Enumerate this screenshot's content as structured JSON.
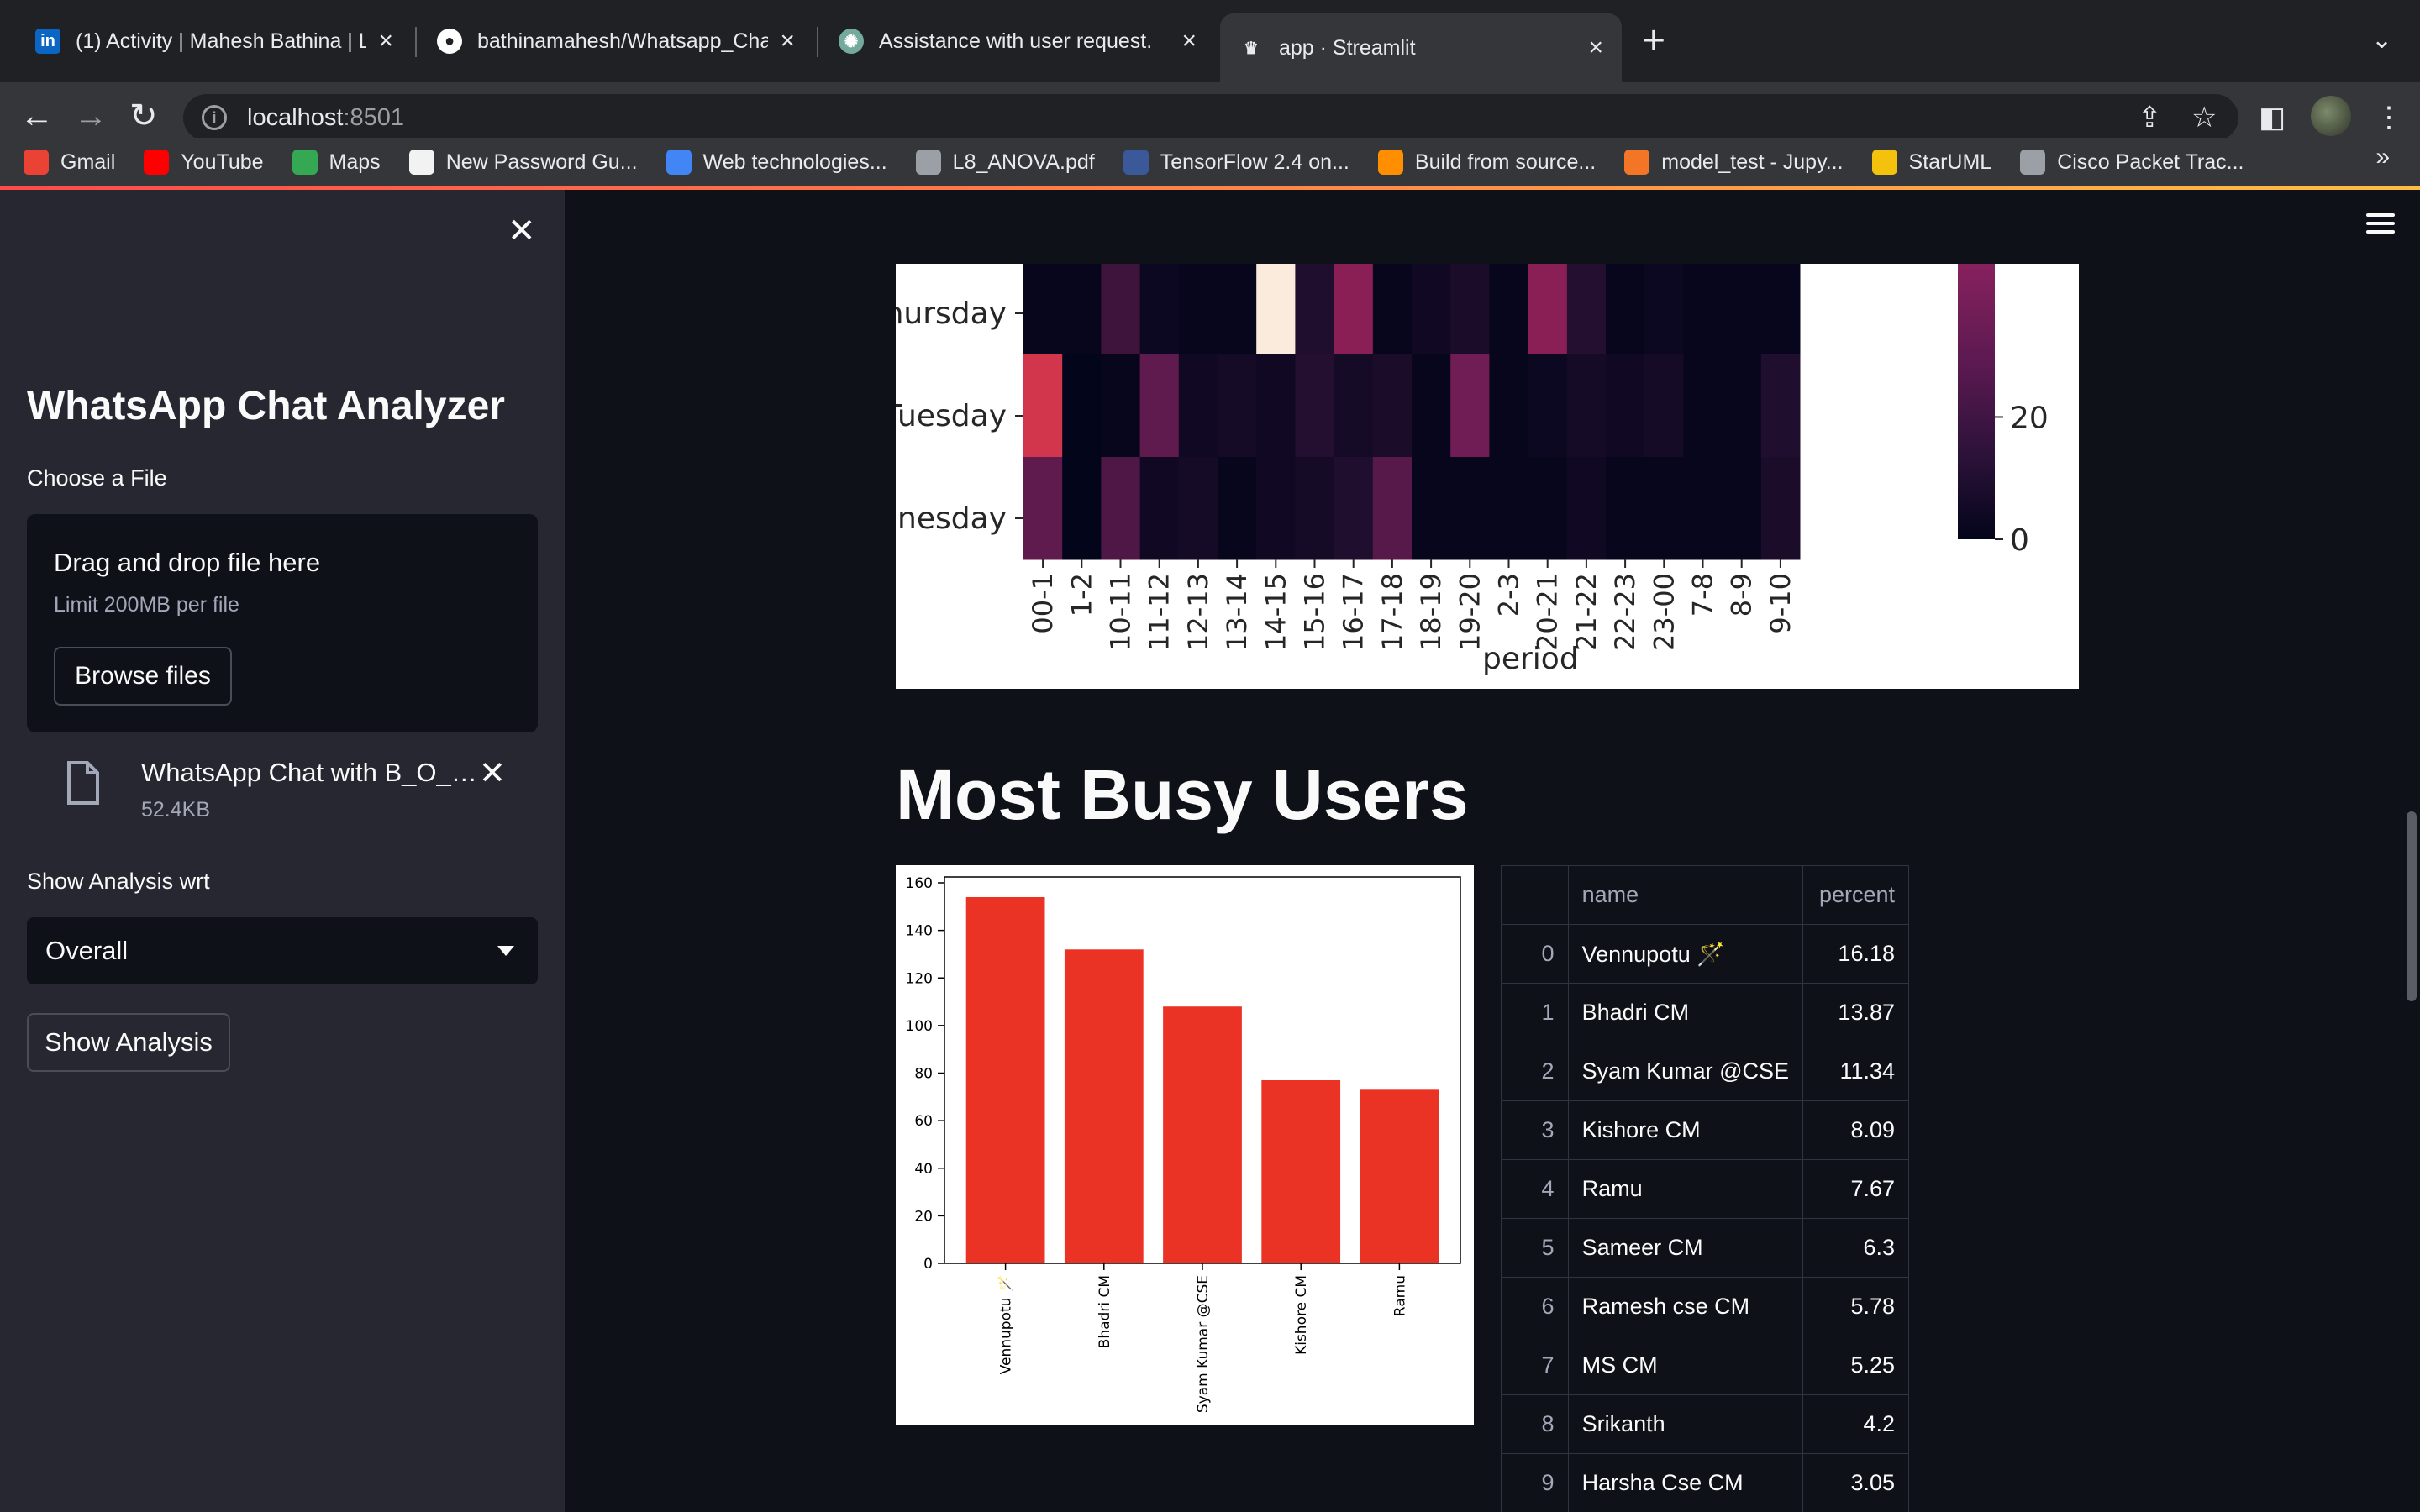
{
  "browser": {
    "tabs": [
      {
        "favicon": "in",
        "favicon_color": "#0a66c2",
        "title": "(1) Activity | Mahesh Bathina | L"
      },
      {
        "favicon": "github-icon",
        "favicon_color": "#ffffff",
        "title": "bathinamahesh/Whatsapp_Cha"
      },
      {
        "favicon": "openai-icon",
        "favicon_color": "#74aa9c",
        "title": "Assistance with user request."
      },
      {
        "favicon": "streamlit-icon",
        "favicon_color": "#ff4b4b",
        "title": "app · Streamlit"
      }
    ],
    "url_host": "localhost",
    "url_port": ":8501",
    "bookmarks": [
      {
        "icon": "gmail-icon",
        "color": "#ea4335",
        "label": "Gmail"
      },
      {
        "icon": "youtube-icon",
        "color": "#ff0000",
        "label": "YouTube"
      },
      {
        "icon": "maps-icon",
        "color": "#34a853",
        "label": "Maps"
      },
      {
        "icon": "password-icon",
        "color": "#f2f2f2",
        "label": "New Password Gu..."
      },
      {
        "icon": "docs-icon",
        "color": "#4285f4",
        "label": "Web technologies..."
      },
      {
        "icon": "globe-icon",
        "color": "#9aa0a6",
        "label": "L8_ANOVA.pdf"
      },
      {
        "icon": "tds-icon",
        "color": "#3b5998",
        "label": "TensorFlow 2.4 on..."
      },
      {
        "icon": "tensorflow-icon",
        "color": "#ff8f00",
        "label": "Build from source..."
      },
      {
        "icon": "jupyter-icon",
        "color": "#f37626",
        "label": "model_test - Jupy..."
      },
      {
        "icon": "staruml-icon",
        "color": "#f4c20d",
        "label": "StarUML"
      },
      {
        "icon": "cisco-icon",
        "color": "#9aa0a6",
        "label": "Cisco Packet Trac..."
      }
    ]
  },
  "sidebar": {
    "title": "WhatsApp Chat Analyzer",
    "file_label": "Choose a File",
    "drop_text": "Drag and drop file here",
    "limit_text": "Limit 200MB per file",
    "browse_label": "Browse files",
    "file_name": "WhatsApp Chat with B_O_Y...",
    "file_size": "52.4KB",
    "analysis_label": "Show Analysis wrt",
    "analysis_value": "Overall",
    "show_button": "Show Analysis"
  },
  "heatmap": {
    "days": [
      "Thursday",
      "Tuesday",
      "Wednesday"
    ],
    "periods": [
      "00-1",
      "1-2",
      "10-11",
      "11-12",
      "12-13",
      "13-14",
      "14-15",
      "15-16",
      "16-17",
      "17-18",
      "18-19",
      "19-20",
      "2-3",
      "20-21",
      "21-22",
      "22-23",
      "23-00",
      "7-8",
      "8-9",
      "9-10"
    ],
    "values": [
      [
        1,
        1,
        10,
        2,
        1,
        1,
        45,
        6,
        20,
        1,
        3,
        5,
        1,
        20,
        7,
        1,
        2,
        1,
        1,
        1
      ],
      [
        30,
        0,
        1,
        14,
        3,
        4,
        3,
        7,
        4,
        5,
        1,
        16,
        1,
        2,
        4,
        3,
        4,
        1,
        1,
        6
      ],
      [
        14,
        0,
        12,
        3,
        4,
        1,
        3,
        4,
        6,
        13,
        1,
        1,
        1,
        1,
        3,
        1,
        1,
        1,
        1,
        5
      ]
    ],
    "xlabel": "period",
    "colorbar_ticks": [
      "0",
      "20"
    ]
  },
  "section_title": "Most Busy Users",
  "chart_data": {
    "type": "bar",
    "categories": [
      "Vennupotu 🪄",
      "Bhadri CM",
      "Syam Kumar @CSE",
      "Kishore CM",
      "Ramu"
    ],
    "values": [
      154,
      132,
      108,
      77,
      73
    ],
    "ylim": [
      0,
      160
    ],
    "yticks": [
      0,
      20,
      40,
      60,
      80,
      100,
      120,
      140,
      160
    ],
    "bar_color": "#ea3324",
    "xlabel": "",
    "ylabel": ""
  },
  "table": {
    "columns": [
      "name",
      "percent"
    ],
    "rows": [
      {
        "idx": "0",
        "name": "Vennupotu 🪄",
        "percent": "16.18"
      },
      {
        "idx": "1",
        "name": "Bhadri CM",
        "percent": "13.87"
      },
      {
        "idx": "2",
        "name": "Syam Kumar @CSE",
        "percent": "11.34"
      },
      {
        "idx": "3",
        "name": "Kishore CM",
        "percent": "8.09"
      },
      {
        "idx": "4",
        "name": "Ramu",
        "percent": "7.67"
      },
      {
        "idx": "5",
        "name": "Sameer CM",
        "percent": "6.3"
      },
      {
        "idx": "6",
        "name": "Ramesh cse CM",
        "percent": "5.78"
      },
      {
        "idx": "7",
        "name": "MS CM",
        "percent": "5.25"
      },
      {
        "idx": "8",
        "name": "Srikanth",
        "percent": "4.2"
      },
      {
        "idx": "9",
        "name": "Harsha Cse CM",
        "percent": "3.05"
      }
    ]
  }
}
